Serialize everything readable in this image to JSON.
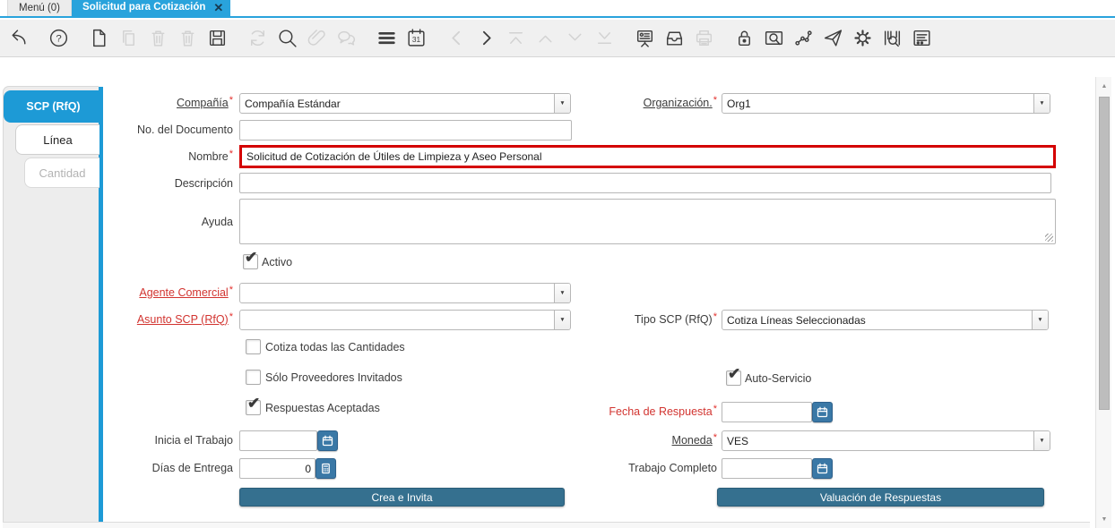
{
  "colors": {
    "accent_blue": "#29a3dc",
    "sidebar_blue": "#1d9ad6",
    "action_button_blue": "#35708f",
    "field_button_blue": "#3a78a6",
    "required_red": "#d23430",
    "focus_border_red": "#d40000"
  },
  "icons": {
    "close": "✕",
    "combo_arrow": "▼",
    "check": "✔",
    "scroll_up": "▲",
    "scroll_down": "▼",
    "help_mark": "?",
    "calendar_day": "31"
  },
  "window_tabs": {
    "menu": {
      "label": "Menú (0)"
    },
    "active": {
      "label": "Solicitud para Cotización"
    }
  },
  "toolbar": {
    "icons": [
      {
        "name": "undo",
        "enabled": true
      },
      {
        "name": "help",
        "enabled": true
      },
      {
        "name": "new-record",
        "enabled": true
      },
      {
        "name": "copy-record",
        "enabled": false
      },
      {
        "name": "delete-record",
        "enabled": false
      },
      {
        "name": "delete-selection",
        "enabled": false
      },
      {
        "name": "save",
        "enabled": true
      },
      {
        "name": "refresh",
        "enabled": false
      },
      {
        "name": "find",
        "enabled": true
      },
      {
        "name": "attachment",
        "enabled": false
      },
      {
        "name": "chat",
        "enabled": false
      },
      {
        "name": "grid-toggle",
        "enabled": true
      },
      {
        "name": "calendar",
        "enabled": true
      },
      {
        "name": "previous-record",
        "enabled": false
      },
      {
        "name": "next-record",
        "enabled": true
      },
      {
        "name": "first-record",
        "enabled": false
      },
      {
        "name": "parent-record",
        "enabled": false
      },
      {
        "name": "detail-record",
        "enabled": false
      },
      {
        "name": "last-record",
        "enabled": false
      },
      {
        "name": "report",
        "enabled": true
      },
      {
        "name": "archive",
        "enabled": true
      },
      {
        "name": "print",
        "enabled": false
      },
      {
        "name": "private-lock",
        "enabled": true
      },
      {
        "name": "zoom-across",
        "enabled": true
      },
      {
        "name": "workflow",
        "enabled": true
      },
      {
        "name": "send-request",
        "enabled": true
      },
      {
        "name": "preferences",
        "enabled": true
      },
      {
        "name": "product-info",
        "enabled": true
      },
      {
        "name": "window-customization",
        "enabled": true
      }
    ]
  },
  "sidebar": {
    "tabs": [
      {
        "label": "SCP (RfQ)",
        "state": "active"
      },
      {
        "label": "Línea",
        "state": "normal"
      },
      {
        "label": "Cantidad",
        "state": "disabled"
      }
    ]
  },
  "form": {
    "required_marker": "*",
    "fields": {
      "compania": {
        "label": "Compañía",
        "value": "Compañía Estándar"
      },
      "organizacion": {
        "label": "Organización.",
        "value": "Org1"
      },
      "no_documento": {
        "label": "No. del Documento",
        "value": ""
      },
      "nombre": {
        "label": "Nombre",
        "value": "Solicitud de Cotización de Útiles de Limpieza y Aseo Personal"
      },
      "descripcion": {
        "label": "Descripción",
        "value": ""
      },
      "ayuda": {
        "label": "Ayuda",
        "value": ""
      },
      "activo": {
        "label": "Activo",
        "checked": true
      },
      "agente_comercial": {
        "label": "Agente Comercial",
        "value": ""
      },
      "asunto_scp": {
        "label": "Asunto SCP (RfQ)",
        "value": ""
      },
      "tipo_scp": {
        "label": "Tipo SCP (RfQ)",
        "value": "Cotiza Líneas Seleccionadas"
      },
      "cotiza_todas": {
        "label": "Cotiza todas las Cantidades",
        "checked": false
      },
      "solo_proveedores": {
        "label": "Sólo Proveedores Invitados",
        "checked": false
      },
      "auto_servicio": {
        "label": "Auto-Servicio",
        "checked": true
      },
      "respuestas_aceptadas": {
        "label": "Respuestas Aceptadas",
        "checked": true
      },
      "fecha_respuesta": {
        "label": "Fecha de Respuesta",
        "value": ""
      },
      "inicia_trabajo": {
        "label": "Inicia el Trabajo",
        "value": ""
      },
      "moneda": {
        "label": "Moneda",
        "value": "VES"
      },
      "dias_entrega": {
        "label": "Días de Entrega",
        "value": "0"
      },
      "trabajo_completo": {
        "label": "Trabajo Completo",
        "value": ""
      }
    },
    "buttons": {
      "crea_invita": "Crea e Invita",
      "valuacion": "Valuación de Respuestas"
    }
  }
}
